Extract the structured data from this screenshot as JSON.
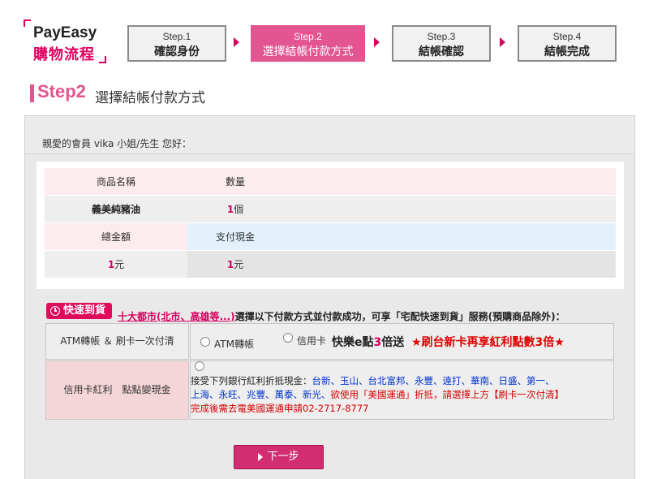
{
  "logo": {
    "brand": "PayEasy",
    "subtitle": "購物流程"
  },
  "steps": [
    {
      "num": "Step.1",
      "label": "確認身份"
    },
    {
      "num": "Step.2",
      "label": "選擇結帳付款方式"
    },
    {
      "num": "Step.3",
      "label": "結帳確認"
    },
    {
      "num": "Step.4",
      "label": "結帳完成"
    }
  ],
  "section": {
    "step": "Step2",
    "title": "選擇結帳付款方式"
  },
  "greeting": "親愛的會員 vika 小姐/先生 您好：",
  "order": {
    "headers": {
      "product": "商品名稱",
      "qty": "數量"
    },
    "product_name": "義美純豬油",
    "qty_value": "1",
    "qty_unit": "個",
    "total_label": "總金額",
    "cash_label": "支付現金",
    "total_value": "1",
    "total_unit": "元",
    "cash_value": "1",
    "cash_unit": "元"
  },
  "express": {
    "badge": "快速到貨",
    "link": "十大都市(北市、高雄等...)",
    "text": "選擇以下付款方式並付款成功，可享「宅配快速到貨」服務(預購商品除外)："
  },
  "payment": {
    "row1_label": "ATM轉帳 ＆ 刷卡一次付清",
    "atm_option": "ATM轉帳",
    "cc_option": "信用卡",
    "happy_pre": "快樂e點",
    "happy_num": "3",
    "happy_post": "倍送",
    "taishin_promo": "★刷台新卡再享紅利點數3倍★",
    "row2_label": "信用卡紅利　點點變現金",
    "card_intro": "接受下列銀行紅利折抵現金：",
    "banks_line1": "台新、玉山、台北富邦、永豐、遠打、華南、日盛、第一、",
    "banks_line2": "上海、永旺、兆豐、萬泰、新光、",
    "usa_note": "欲使用「美國運通」折抵，請選擇上方【刷卡一次付清】",
    "usa_phone": "完成後需去電美國運通申請02-2717-8777"
  },
  "next_button": "下一步",
  "colors": {
    "accent": "#e25590",
    "brand": "#d6005e",
    "promo_red": "#e00000",
    "bank_blue": "#0033cc"
  }
}
